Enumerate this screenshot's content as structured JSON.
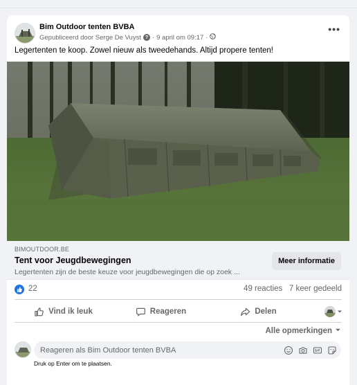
{
  "post": {
    "page_name": "Bim Outdoor tenten BVBA",
    "published_by": "Gepubliceerd door Serge De Vuyst",
    "separator": "·",
    "timestamp": "9 april om 09:17",
    "more_label": "•••",
    "text": "Legertenten te koop. Zowel nieuw als tweedehands. Altijd propere tenten!"
  },
  "link": {
    "domain": "BIMOUTDOOR.BE",
    "title": "Tent voor Jeugdbewegingen",
    "description": "Legertenten zijn de beste keuze voor jeugdbewegingen die op zoek ...",
    "cta": "Meer informatie"
  },
  "stats": {
    "likes": "22",
    "comments": "49 reacties",
    "shares": "7 keer gedeeld"
  },
  "actions": {
    "like": "Vind ik leuk",
    "comment": "Reageren",
    "share": "Delen"
  },
  "comments": {
    "filter": "Alle opmerkingen",
    "placeholder": "Reageren als Bim Outdoor tenten BVBA",
    "hint": "Druk op Enter om te plaatsen."
  },
  "colors": {
    "like_blue": "#2374e1",
    "secondary_text": "#65676b",
    "cta_bg": "#e4e6eb"
  },
  "icons": [
    "globe-icon",
    "question-icon",
    "like-reaction-icon",
    "thumbs-up-icon",
    "comment-icon",
    "share-icon",
    "chevron-down-icon",
    "emoji-icon",
    "camera-icon",
    "gif-icon",
    "sticker-icon"
  ]
}
